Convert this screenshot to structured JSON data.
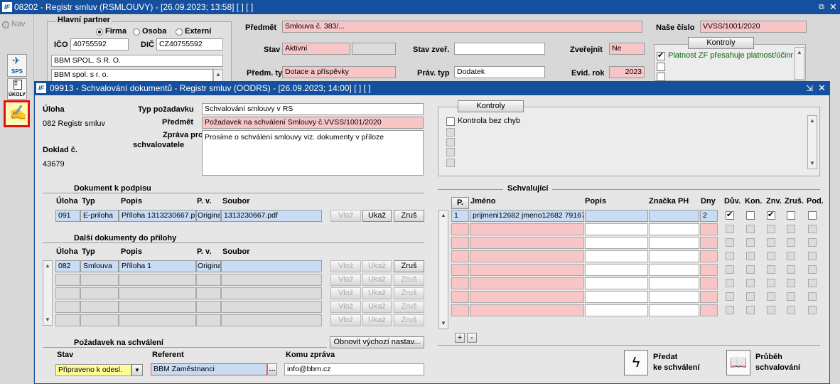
{
  "colors": {
    "titlebar": "#14509e",
    "required": "#f8c6c6",
    "current": "#c8dcf4",
    "highlight": "#ffff99"
  },
  "main_window": {
    "title": "08202 - Registr smluv (RSMLOUVY) - [26.09.2023; 13:58]  [ ]  [ ]"
  },
  "left_toolbar": {
    "nav": "Nav",
    "sps": "SPS",
    "ukoly": "ÚKOLY"
  },
  "partner": {
    "section": "Hlavní partner",
    "radio_firma": "Firma",
    "radio_osoba": "Osoba",
    "radio_externi": "Externí",
    "ico_label": "IČO",
    "ico_value": "40755592",
    "dic_label": "DIČ",
    "dic_value": "CZ40755592",
    "name1": "BBM SPOL. S R. O.",
    "name2": "BBM spol. s r. o."
  },
  "contract": {
    "predmet_label": "Předmět",
    "predmet_value": "Smlouva č. 383/...",
    "stav_label": "Stav",
    "stav_value": "Aktivní",
    "stav_zver_label": "Stav zveř.",
    "zverejnit_label": "Zveřejnit",
    "zverejnit_value": "Ne",
    "predm_typ_label": "Předm. typ",
    "predm_typ_value": "Dotace a příspěvky",
    "prav_typ_label": "Práv. typ",
    "prav_typ_value": "Dodatek",
    "evid_rok_label": "Evid. rok",
    "evid_rok_value": "2023",
    "nase_cislo_label": "Naše číslo",
    "nase_cislo_value": "VVSS/1001/2020",
    "kontroly_button": "Kontroly",
    "kontrola_item": "Platnost ZF přesahuje platnost/účinn"
  },
  "dialog": {
    "title": "09913 - Schvalování dokumentů - Registr smluv (OODRS) - [26.09.2023; 14:00]  [ ]  [ ]",
    "uloha_label": "Úloha",
    "uloha_value": "082 Registr smluv",
    "doklad_label": "Doklad č.",
    "doklad_value": "43679",
    "typ_pozadavku_label": "Typ požadavku",
    "typ_pozadavku_value": "Schvalování smlouvy v RS",
    "predmet_label": "Předmět",
    "predmet_value": "Požadavek na schválení Smlouvy č.VVSS/1001/2020",
    "zprava_label1": "Zpráva pro",
    "zprava_label2": "schvalovatele",
    "zprava_value": "Prosíme o schválení smlouvy viz. dokumenty v příloze",
    "kontroly_button": "Kontroly",
    "kontrola_item": "Kontrola bez chyb"
  },
  "doc_sign": {
    "section": "Dokument k podpisu",
    "headers": [
      "Úloha",
      "Typ",
      "Popis",
      "P. v.",
      "Soubor"
    ],
    "row": [
      "091",
      "E-priloha",
      "Příloha 1313230667.p",
      "Origina",
      "1313230667.pdf"
    ],
    "btn_vloz": "Vlož",
    "btn_ukaz": "Ukaž",
    "btn_zrus": "Zruš"
  },
  "other_docs": {
    "section": "Další dokumenty do přílohy",
    "headers": [
      "Úloha",
      "Typ",
      "Popis",
      "P. v.",
      "Soubor"
    ],
    "row": [
      "082",
      "Smlouva",
      "Příloha 1",
      "Origina",
      ""
    ],
    "btn_vloz": "Vlož",
    "btn_ukaz": "Ukaž",
    "btn_zrus": "Zruš"
  },
  "request": {
    "section": "Požadavek na schválení",
    "reset_button": "Obnovit výchozí nastav...",
    "stav_label": "Stav",
    "stav_value": "Připraveno k odesl.",
    "referent_label": "Referent",
    "referent_value": "BBM Zaměstnanci",
    "komu_label": "Komu zpráva",
    "komu_value": "info@bbm.cz"
  },
  "approvers": {
    "section": "Schvalující",
    "headers": {
      "p": "P.",
      "jmeno": "Jméno",
      "popis": "Popis",
      "znacka": "Značka PH",
      "dny": "Dny",
      "duv": "Dův.",
      "kon": "Kon.",
      "znv": "Znv.",
      "zrus": "Zruš.",
      "pod": "Pod."
    },
    "row1": {
      "p": "1",
      "jmeno": "prijmeni12682 jmeno12682 79167",
      "dny": "2"
    },
    "plus": "+",
    "minus": "-"
  },
  "actions": {
    "predat_line1": "Předat",
    "predat_line2": "ke schválení",
    "prubeh_line1": "Průběh",
    "prubeh_line2": "schvalování"
  }
}
